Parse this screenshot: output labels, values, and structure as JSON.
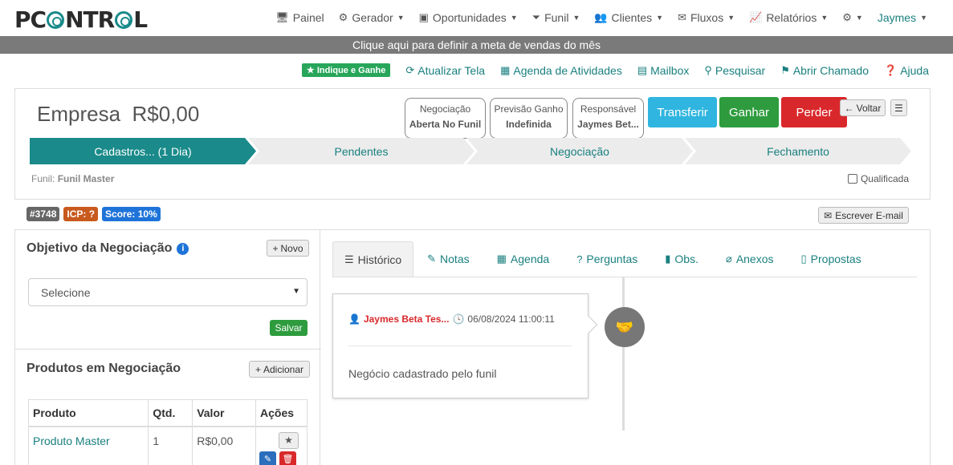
{
  "nav": {
    "logo_left": "P",
    "logo_mid": "C",
    "logo_right": "NTR",
    "logo_end": "L",
    "items": [
      {
        "label": "Painel",
        "icon": "monitor-icon",
        "caret": false
      },
      {
        "label": "Gerador",
        "icon": "robot-icon",
        "caret": true
      },
      {
        "label": "Oportunidades",
        "icon": "address-card-icon",
        "caret": true
      },
      {
        "label": "Funil",
        "icon": "filter-icon",
        "caret": true
      },
      {
        "label": "Clientes",
        "icon": "users-icon",
        "caret": true
      },
      {
        "label": "Fluxos",
        "icon": "envelope-icon",
        "caret": true
      },
      {
        "label": "Relatórios",
        "icon": "line-chart-icon",
        "caret": true
      }
    ],
    "user": "Jaymes"
  },
  "goal_bar": "Clique aqui para definir a meta de vendas do mês",
  "actions": {
    "indique": "Indique e Ganhe",
    "atualizar": "Atualizar Tela",
    "agenda": "Agenda de Atividades",
    "mailbox": "Mailbox",
    "pesquisar": "Pesquisar",
    "chamado": "Abrir Chamado",
    "ajuda": "Ajuda"
  },
  "header": {
    "title": "Empresa",
    "amount": "R$0,00",
    "info": [
      {
        "label": "Negociação",
        "value": "Aberta No Funil"
      },
      {
        "label": "Previsão Ganho",
        "value": "Indefinida"
      },
      {
        "label": "Responsável",
        "value": "Jaymes Bet..."
      }
    ],
    "transferir": "Transferir",
    "ganhar": "Ganhar",
    "perder": "Perder",
    "voltar": "Voltar",
    "stages": [
      "Cadastros... (1 Dia)",
      "Pendentes",
      "Negociação",
      "Fechamento"
    ],
    "funil_label": "Funil:",
    "funil_name": "Funil Master",
    "qualificada": "Qualificada"
  },
  "badges": {
    "id": "#3748",
    "icp": "ICP: ?",
    "score": "Score: 10%"
  },
  "email_button": "Escrever E-mail",
  "objetivo": {
    "title": "Objetivo da Negociação",
    "novo": "Novo",
    "select_value": "Selecione",
    "salvar": "Salvar"
  },
  "produtos": {
    "title": "Produtos em Negociação",
    "adicionar": "Adicionar",
    "columns": [
      "Produto",
      "Qtd.",
      "Valor",
      "Ações"
    ],
    "rows": [
      {
        "produto": "Produto Master",
        "qtd": "1",
        "valor": "R$0,00"
      }
    ]
  },
  "tabs": [
    {
      "label": "Histórico",
      "icon": "list-icon",
      "active": true
    },
    {
      "label": "Notas",
      "icon": "edit-icon",
      "active": false
    },
    {
      "label": "Agenda",
      "icon": "calendar-icon",
      "active": false
    },
    {
      "label": "Perguntas",
      "icon": "question-circle-icon",
      "active": false
    },
    {
      "label": "Obs.",
      "icon": "book-icon",
      "active": false
    },
    {
      "label": "Anexos",
      "icon": "paperclip-icon",
      "active": false
    },
    {
      "label": "Propostas",
      "icon": "file-icon",
      "active": false
    }
  ],
  "history": {
    "author": "Jaymes Beta Tes...",
    "date": "06/08/2024 11:00:11",
    "text": "Negócio cadastrado pelo funil"
  },
  "colors": {
    "brand": "#1a7f7f",
    "active_stage": "#1a8a8a",
    "inactive_stage": "#ececec"
  }
}
